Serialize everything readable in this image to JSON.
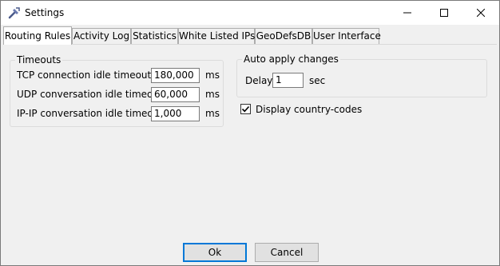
{
  "window": {
    "title": "Settings",
    "icon": "settings-tool-icon",
    "controls": [
      "minimize-icon",
      "maximize-icon",
      "close-icon"
    ]
  },
  "tabs": [
    {
      "label": "Routing Rules",
      "active": true
    },
    {
      "label": "Activity Log",
      "active": false
    },
    {
      "label": "Statistics",
      "active": false
    },
    {
      "label": "White Listed IPs",
      "active": false
    },
    {
      "label": "GeoDefsDB",
      "active": false
    },
    {
      "label": "User Interface",
      "active": false
    }
  ],
  "timeouts": {
    "title": "Timeouts",
    "rows": [
      {
        "label": "TCP connection idle timeout",
        "value": "180,000",
        "unit": "ms"
      },
      {
        "label": "UDP conversation idle timeout",
        "value": "60,000",
        "unit": "ms"
      },
      {
        "label": "IP-IP conversation idle timeout",
        "value": "1,000",
        "unit": "ms"
      }
    ]
  },
  "auto_apply": {
    "title": "Auto apply changes",
    "delay_label": "Delay",
    "delay_value": "1",
    "delay_unit": "sec"
  },
  "country_codes": {
    "label": "Display country-codes",
    "checked": true
  },
  "buttons": {
    "ok": "Ok",
    "cancel": "Cancel"
  },
  "colors": {
    "accent": "#0078d7",
    "background": "#f0f0f0"
  }
}
